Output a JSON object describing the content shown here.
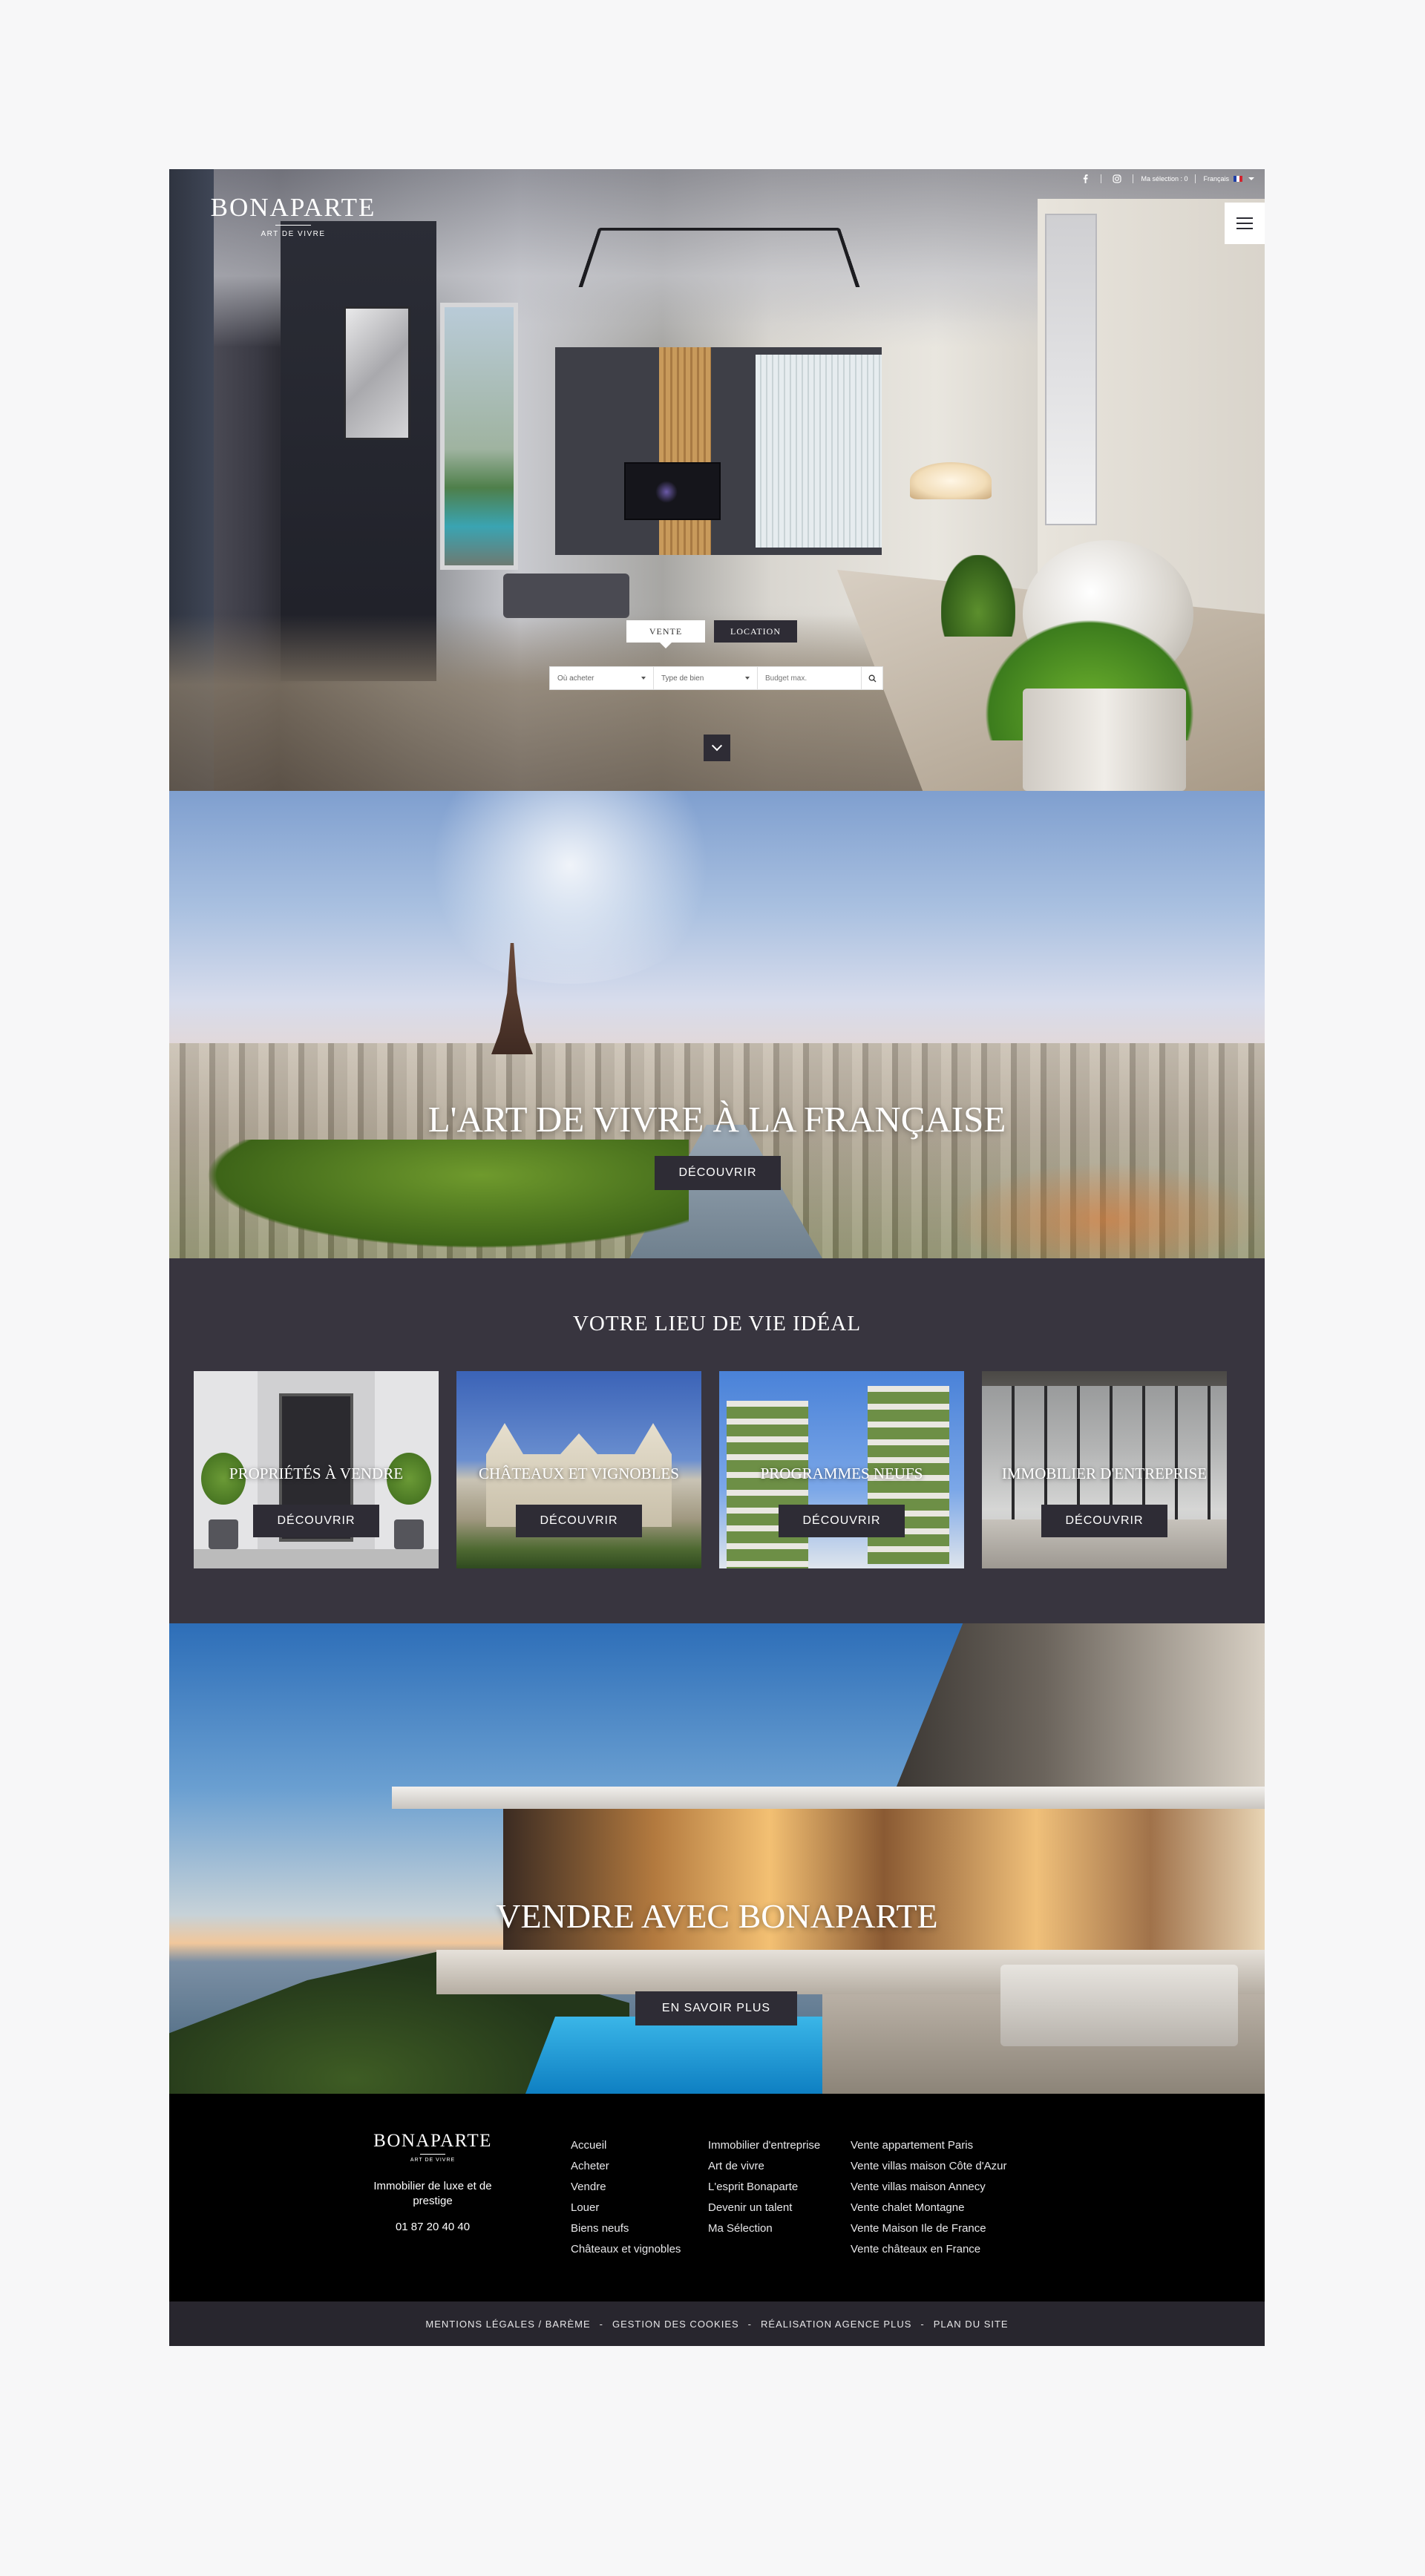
{
  "header": {
    "topbar": {
      "facebook_icon": "facebook-icon",
      "instagram_icon": "instagram-icon",
      "selection": "Ma sélection : 0",
      "language": "Français"
    },
    "logo": {
      "name": "BONAPARTE",
      "tagline": "ART DE VIVRE"
    },
    "menu_icon": "hamburger-icon"
  },
  "search": {
    "tabs": [
      {
        "label": "VENTE",
        "active": true
      },
      {
        "label": "LOCATION",
        "active": false
      }
    ],
    "where_placeholder": "Où acheter",
    "type_placeholder": "Type de bien",
    "budget_placeholder": "Budget max.",
    "search_icon": "search-icon",
    "scroll_icon": "chevron-down-icon"
  },
  "art_de_vivre": {
    "title": "L'ART DE VIVRE À LA FRANÇAISE",
    "button": "DÉCOUVRIR"
  },
  "lieu": {
    "title": "VOTRE LIEU DE VIE IDÉAL",
    "cards": [
      {
        "label": "PROPRIÉTÉS À VENDRE",
        "button": "DÉCOUVRIR"
      },
      {
        "label": "CHÂTEAUX ET VIGNOBLES",
        "button": "DÉCOUVRIR"
      },
      {
        "label": "PROGRAMMES NEUFS",
        "button": "DÉCOUVRIR"
      },
      {
        "label": "IMMOBILIER D'ENTREPRISE",
        "button": "DÉCOUVRIR"
      }
    ]
  },
  "vendre": {
    "title": "VENDRE AVEC BONAPARTE",
    "button": "EN SAVOIR PLUS"
  },
  "footer": {
    "logo": {
      "name": "BONAPARTE",
      "tagline": "ART DE VIVRE"
    },
    "tagline": "Immobilier de luxe et de prestige",
    "phone": "01 87 20 40 40",
    "col1": [
      "Accueil",
      "Acheter",
      "Vendre",
      "Louer",
      "Biens neufs",
      "Châteaux et vignobles"
    ],
    "col2": [
      "Immobilier d'entreprise",
      "Art de vivre",
      "L'esprit Bonaparte",
      "Devenir un talent",
      "Ma Sélection"
    ],
    "col3": [
      "Vente appartement Paris",
      "Vente villas maison Côte d'Azur",
      "Vente villas maison Annecy",
      "Vente chalet Montagne",
      "Vente Maison Ile de France",
      "Vente châteaux en France"
    ]
  },
  "subfooter": {
    "links": [
      "MENTIONS LÉGALES / BARÈME",
      "GESTION DES COOKIES",
      "RÉALISATION AGENCE PLUS",
      "PLAN DU SITE"
    ],
    "separator": "-"
  }
}
